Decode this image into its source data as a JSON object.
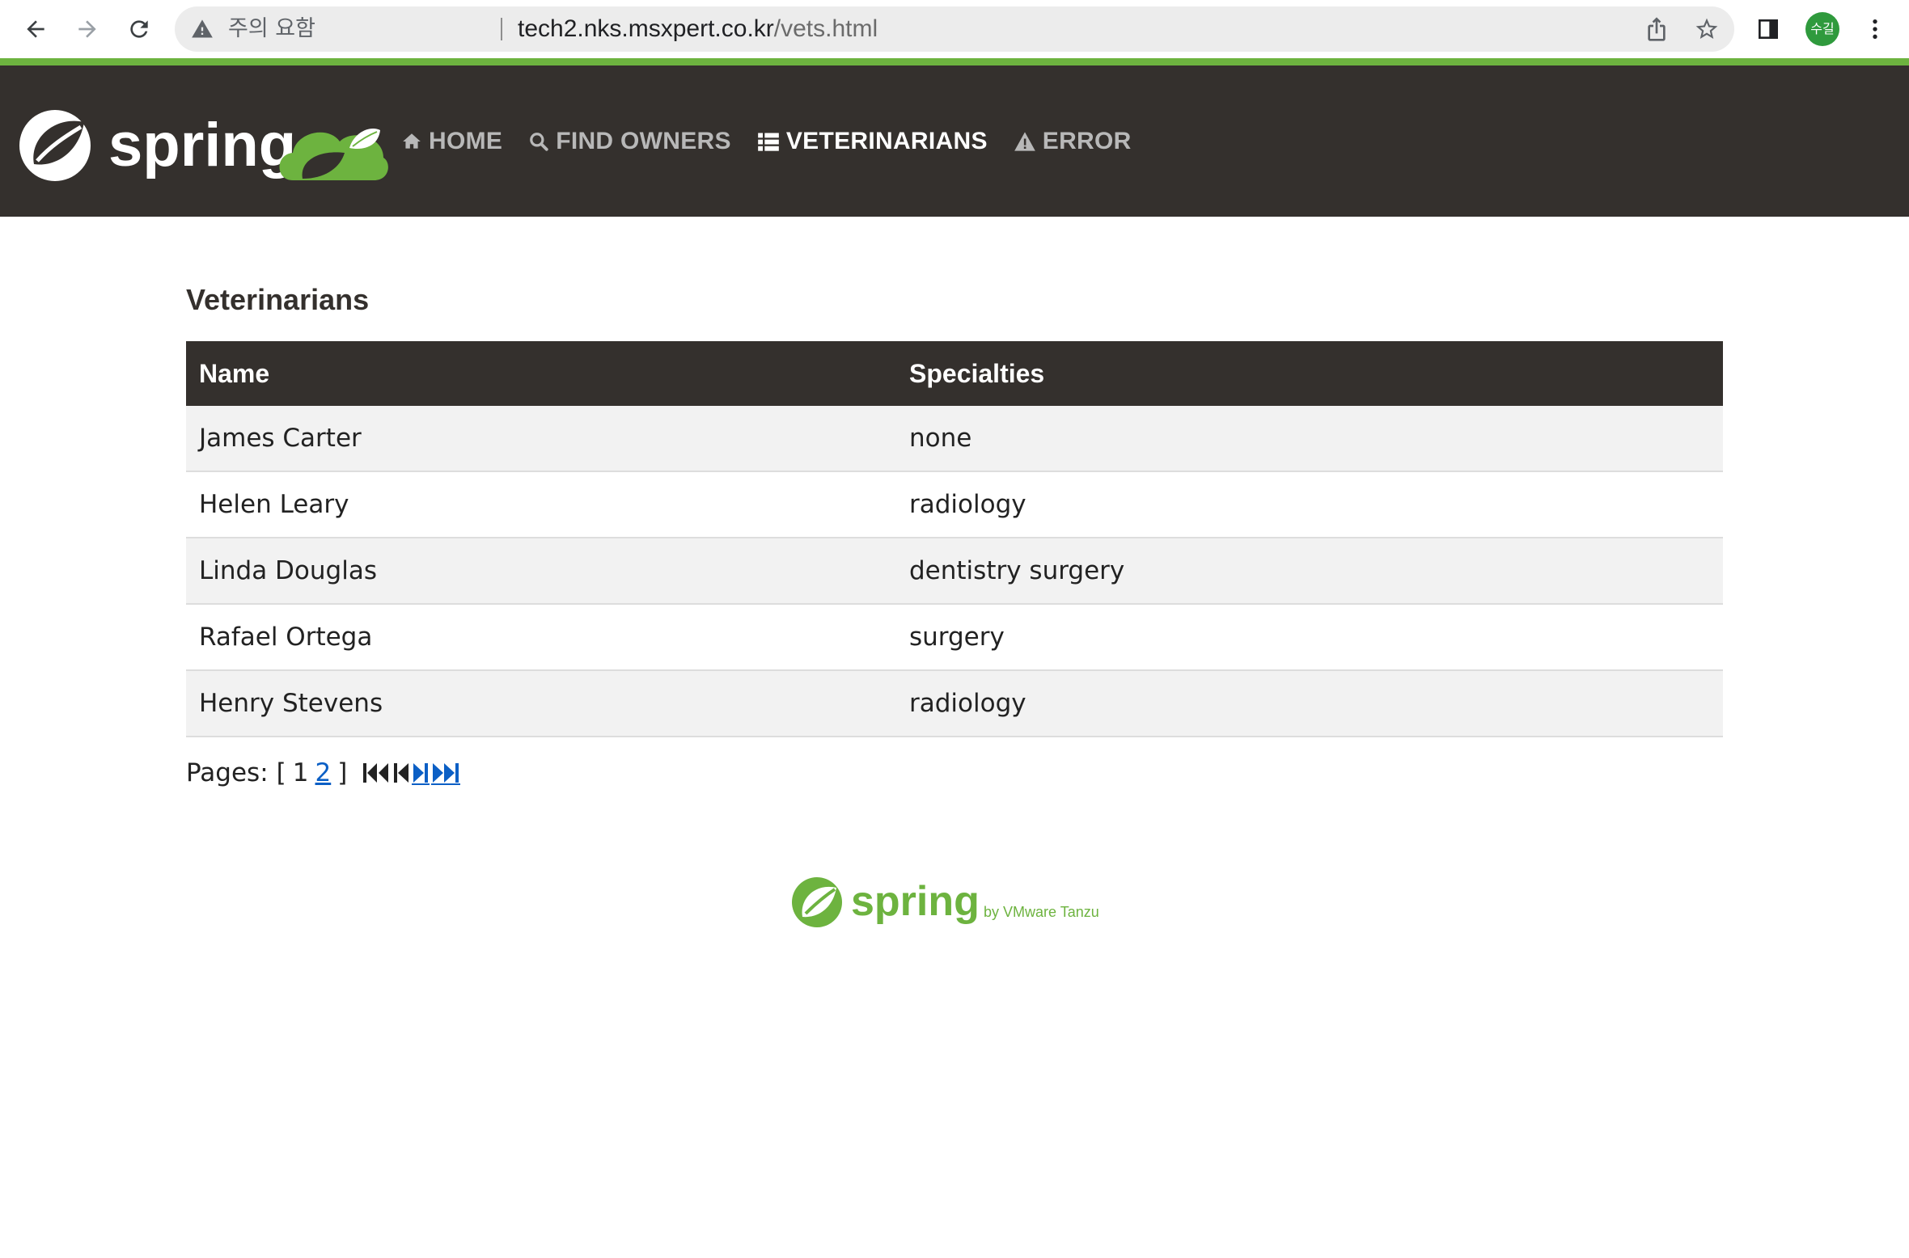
{
  "browser": {
    "security_label": "주의 요함",
    "url_host": "tech2.nks.msxpert.co.kr",
    "url_path": "/vets.html",
    "profile_initials": "수길"
  },
  "logo": {
    "text": "spring"
  },
  "nav": {
    "items": [
      {
        "label": "HOME",
        "icon": "home-icon",
        "active": false
      },
      {
        "label": "FIND OWNERS",
        "icon": "search-icon",
        "active": false
      },
      {
        "label": "VETERINARIANS",
        "icon": "list-icon",
        "active": true
      },
      {
        "label": "ERROR",
        "icon": "warning-icon",
        "active": false
      }
    ]
  },
  "page": {
    "title": "Veterinarians",
    "table": {
      "columns": [
        "Name",
        "Specialties"
      ],
      "rows": [
        {
          "name": "James Carter",
          "specialties": "none"
        },
        {
          "name": "Helen Leary",
          "specialties": "radiology"
        },
        {
          "name": "Linda Douglas",
          "specialties": "dentistry surgery"
        },
        {
          "name": "Rafael Ortega",
          "specialties": "surgery"
        },
        {
          "name": "Henry Stevens",
          "specialties": "radiology"
        }
      ]
    },
    "pager": {
      "label": "Pages:",
      "open_bracket": "[",
      "current_page": "1",
      "next_page": "2",
      "close_bracket": "]"
    }
  },
  "footer": {
    "brand": "spring",
    "byline": "by VMware Tanzu"
  },
  "colors": {
    "navbar": "#34302d",
    "brand_green": "#6db33f",
    "link_blue": "#0b5fc5",
    "row_stripe": "#f2f2f2"
  }
}
